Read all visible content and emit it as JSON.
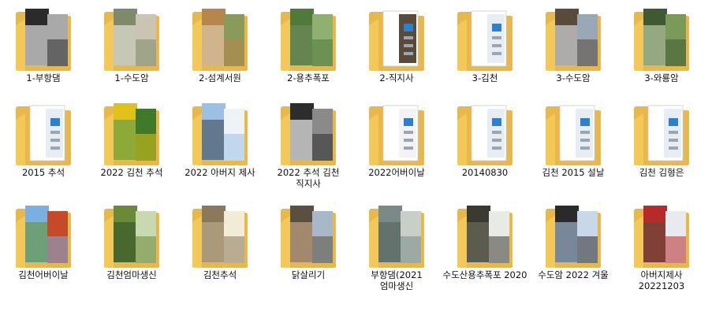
{
  "folders": [
    {
      "name": "1-부항댐",
      "kind": "photo",
      "c1": "#2b2b2b",
      "c2": "#a9a9a9",
      "c3": "#e0e0e0"
    },
    {
      "name": "1-수도암",
      "kind": "photo",
      "c1": "#7e8a6a",
      "c2": "#c9c4b3",
      "c3": "#e6e2d6"
    },
    {
      "name": "2-섬계서원",
      "kind": "photo",
      "c1": "#b8864a",
      "c2": "#8a9a5a",
      "c3": "#d8c8a8"
    },
    {
      "name": "2-용추폭포",
      "kind": "photo",
      "c1": "#4f7a3a",
      "c2": "#8fb070",
      "c3": "#6d8a55"
    },
    {
      "name": "2-직지사",
      "kind": "doc",
      "c1": "#5a4a3a",
      "c2": "#d8e0ea",
      "c3": "#8a7a6a"
    },
    {
      "name": "3-김천",
      "kind": "doc",
      "c1": "#e8edf3",
      "c2": "#ffffff",
      "c3": "#cfd8e2"
    },
    {
      "name": "3-수도암",
      "kind": "photo",
      "c1": "#5a4a3a",
      "c2": "#9aa7b5",
      "c3": "#d0d6dc"
    },
    {
      "name": "3-와룡암",
      "kind": "photo",
      "c1": "#3f5a32",
      "c2": "#7b9a5a",
      "c3": "#b9c9a3"
    },
    {
      "name": "2015 추석",
      "kind": "doc",
      "c1": "#e8edf3",
      "c2": "#ffffff",
      "c3": "#cfd8e2"
    },
    {
      "name": "2022 김천 추석",
      "kind": "photo",
      "c1": "#e0c21a",
      "c2": "#3e7a2a",
      "c3": "#6aa046"
    },
    {
      "name": "2022 아버지 제사",
      "kind": "photo",
      "c1": "#9cc0e4",
      "c2": "#eef3f8",
      "c3": "#4a5a6a"
    },
    {
      "name": "2022 추석 김천 직지사",
      "kind": "photo",
      "c1": "#2d2d2d",
      "c2": "#8a8a8a",
      "c3": "#f0f0f0"
    },
    {
      "name": "2022어버이날",
      "kind": "doc",
      "c1": "#f3f3f3",
      "c2": "#cfd6dc",
      "c3": "#9aa3ab"
    },
    {
      "name": "20140830",
      "kind": "doc",
      "c1": "#e8edf3",
      "c2": "#ffffff",
      "c3": "#cfd8e2"
    },
    {
      "name": "김천 2015 설날",
      "kind": "doc",
      "c1": "#e8edf3",
      "c2": "#ffffff",
      "c3": "#cfd8e2"
    },
    {
      "name": "김천 김형은",
      "kind": "doc",
      "c1": "#e8edf3",
      "c2": "#ffffff",
      "c3": "#cfd8e2"
    },
    {
      "name": "김천어버이날",
      "kind": "photo",
      "c1": "#7ab0e0",
      "c2": "#c44a2a",
      "c3": "#6a9a4a"
    },
    {
      "name": "김천엄마생신",
      "kind": "photo",
      "c1": "#6a8a3a",
      "c2": "#c8d8b0",
      "c3": "#3a5a2a"
    },
    {
      "name": "김천추석",
      "kind": "photo",
      "c1": "#8a7a5a",
      "c2": "#f0ecd8",
      "c3": "#b8a888"
    },
    {
      "name": "닭살리기",
      "kind": "photo",
      "c1": "#5a5040",
      "c2": "#a8b8c8",
      "c3": "#c0a080"
    },
    {
      "name": "부항댐(2021 엄마생신",
      "kind": "photo",
      "c1": "#7a8a88",
      "c2": "#c8cec8",
      "c3": "#5a6a60"
    },
    {
      "name": "수도산용추폭포 2020",
      "kind": "photo",
      "c1": "#3a3a32",
      "c2": "#e8eae6",
      "c3": "#6a6a5a"
    },
    {
      "name": "수도암 2022 겨울",
      "kind": "photo",
      "c1": "#2a2a2a",
      "c2": "#c8d8e8",
      "c3": "#9ab0c8"
    },
    {
      "name": "아버지제사 20221203",
      "kind": "photo",
      "c1": "#b82a2a",
      "c2": "#e8eaf0",
      "c3": "#6a4a3a"
    }
  ]
}
